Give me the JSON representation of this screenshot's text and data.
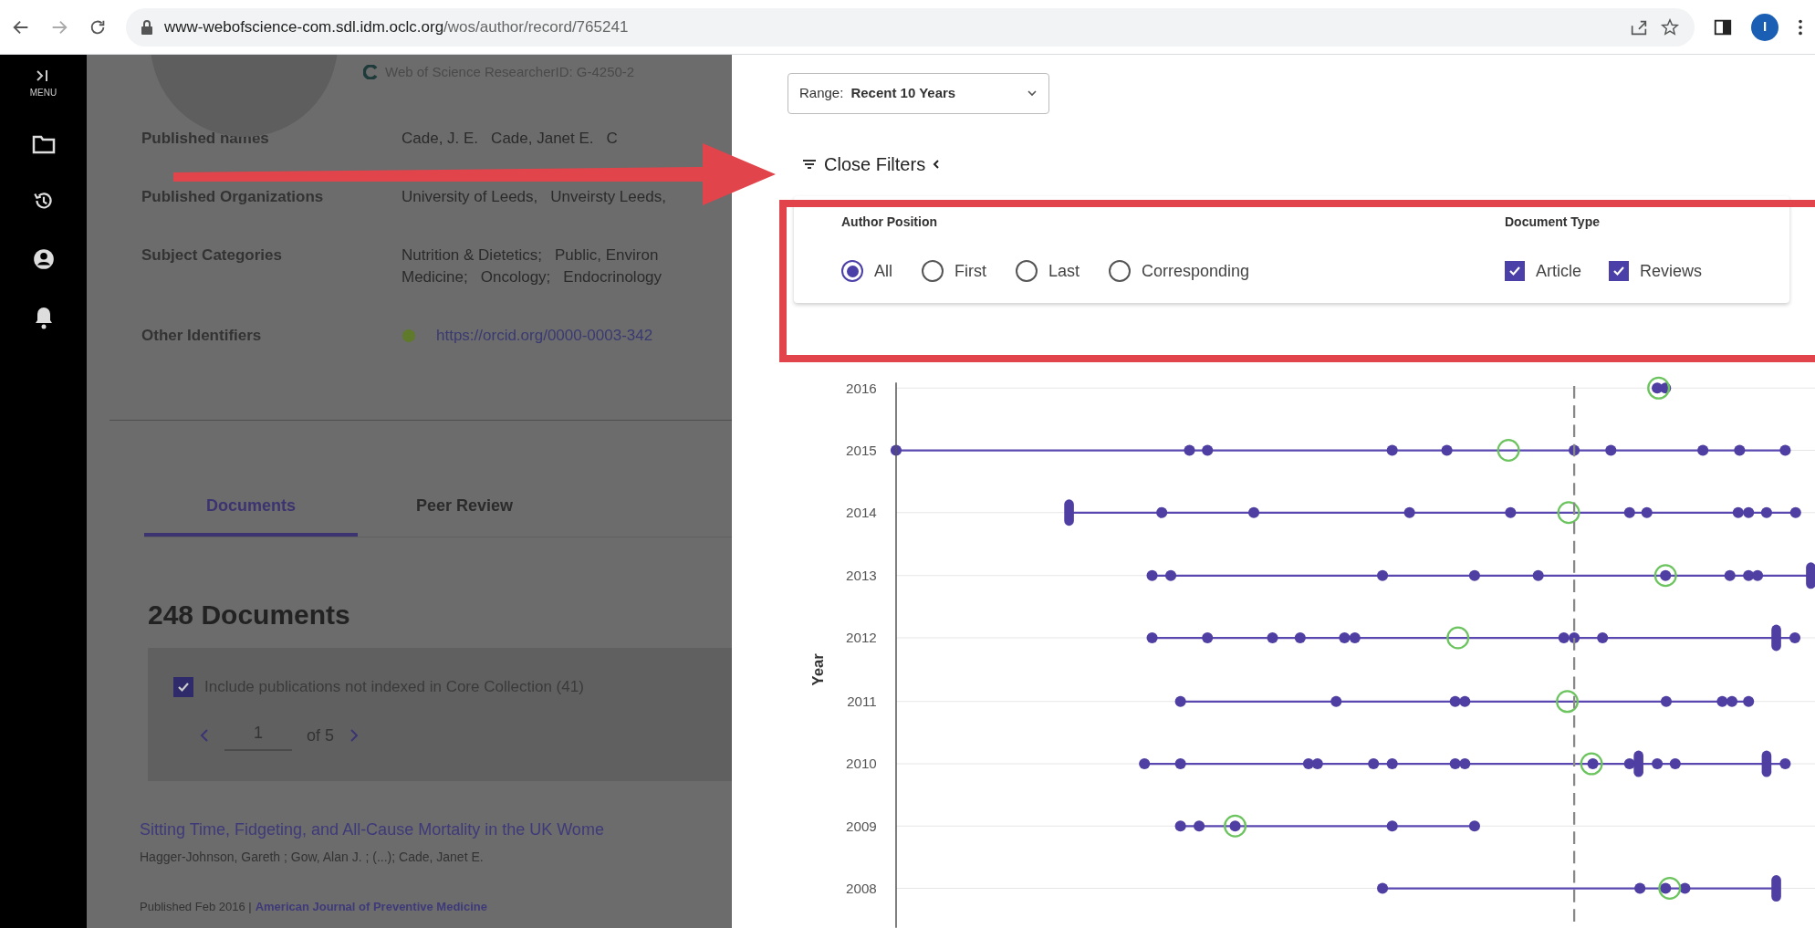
{
  "browser": {
    "url_host": "www-webofscience-com.sdl.idm.oclc.org",
    "url_path": "/wos/author/record/765241",
    "profile_initial": "I"
  },
  "sidebar": {
    "menu_label": "MENU"
  },
  "profile": {
    "researcher_id": "Web of Science ResearcherID: G-4250-2",
    "fields": [
      {
        "label": "Published names",
        "kind": "text",
        "lines": [
          [
            "Cade, J. E.",
            "Cade, Janet E.",
            "C"
          ]
        ]
      },
      {
        "label": "Published Organizations",
        "kind": "text",
        "lines": [
          [
            "University of Leeds,",
            "Unveirsty Leeds,"
          ]
        ]
      },
      {
        "label": "Subject Categories",
        "kind": "text",
        "lines": [
          [
            "Nutrition & Dietetics;",
            "Public, Environ"
          ],
          [
            "Medicine;",
            "Oncology;",
            "Endocrinology"
          ]
        ]
      },
      {
        "label": "Other Identifiers",
        "kind": "link",
        "lines": [
          [
            "https://orcid.org/0000-0003-342"
          ]
        ]
      }
    ]
  },
  "tabs": [
    {
      "label": "Documents",
      "selected": true
    },
    {
      "label": "Peer Review",
      "selected": false
    }
  ],
  "documents": {
    "heading": "248 Documents",
    "include": {
      "label": "Include publications not indexed in Core Collection (41)",
      "checked": true
    },
    "pager": {
      "page": "1",
      "of": "of 5"
    }
  },
  "record": {
    "title": "Sitting Time, Fidgeting, and All-Cause Mortality in the UK Wome",
    "authors": "Hagger-Johnson, Gareth ; Gow, Alan J. ; (...); Cade, Janet E.",
    "published": "Published Feb 2016 |",
    "journal": "American Journal of Preventive Medicine"
  },
  "panel": {
    "range": {
      "label": "Range:",
      "value": "Recent 10 Years"
    },
    "close_filters": "Close Filters",
    "author_position": {
      "title": "Author Position",
      "options": [
        {
          "label": "All",
          "selected": true
        },
        {
          "label": "First",
          "selected": false
        },
        {
          "label": "Last",
          "selected": false
        },
        {
          "label": "Corresponding",
          "selected": false
        }
      ]
    },
    "document_type": {
      "title": "Document Type",
      "options": [
        {
          "label": "Article",
          "checked": true
        },
        {
          "label": "Reviews",
          "checked": true
        }
      ]
    }
  },
  "chart": {
    "y_axis_label": "Year",
    "year_labels": [
      "2016",
      "2015",
      "2014",
      "2013",
      "2012",
      "2011",
      "2010",
      "2009",
      "2008"
    ]
  }
}
